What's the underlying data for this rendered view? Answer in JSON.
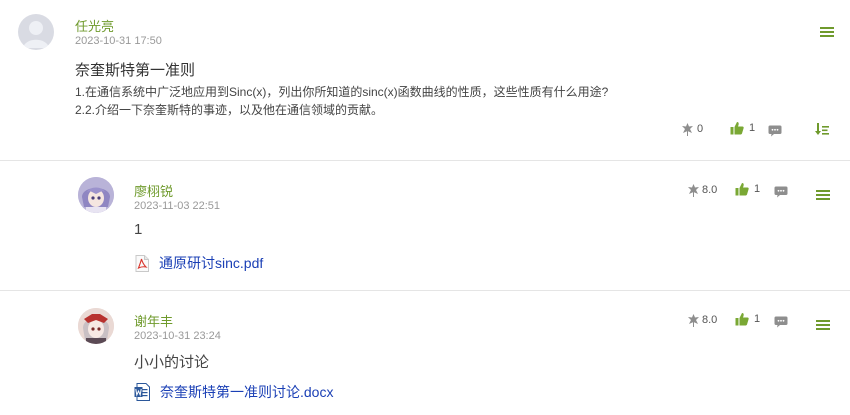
{
  "post": {
    "author": "任光亮",
    "time": "2023-10-31 17:50",
    "title": "奈奎斯特第一准则",
    "question_1": "1.在通信系统中广泛地应用到Sinc(x)，列出你所知道的sinc(x)函数曲线的性质，这些性质有什么用途?",
    "question_2": "2.2.介绍一下奈奎斯特的事迹，以及他在通信领域的贡献。",
    "rating": "0",
    "likes": "1"
  },
  "replies": [
    {
      "author": "廖栩锐",
      "time": "2023-11-03 22:51",
      "text": "1",
      "rating": "8.0",
      "likes": "1",
      "attachment": "通原研讨sinc.pdf"
    },
    {
      "author": "谢年丰",
      "time": "2023-10-31 23:24",
      "text": "小小的讨论",
      "rating": "8.0",
      "likes": "1",
      "attachment": "奈奎斯特第一准则讨论.docx"
    }
  ],
  "icons": {
    "menu": "hamburger-menu-icon",
    "rating": "flower-rating-icon",
    "like": "thumbs-up-icon",
    "comment": "speech-bubble-icon",
    "sort": "sort-down-icon",
    "pdf": "pdf-file-icon",
    "docx": "word-file-icon"
  },
  "colors": {
    "name": "#6f9a2c",
    "like": "#7aa834",
    "link": "#1a3fb5",
    "icon_grey": "#8e8e8e"
  }
}
